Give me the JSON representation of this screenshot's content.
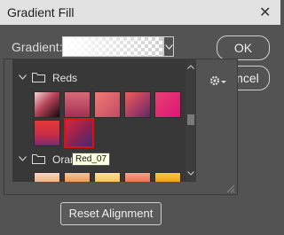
{
  "window": {
    "title": "Gradient Fill"
  },
  "gradient": {
    "label": "Gradient:"
  },
  "buttons": {
    "ok": "OK",
    "cancel": "Cancel",
    "reset_alignment": "Reset Alignment"
  },
  "picker": {
    "groups": [
      {
        "name": "Reds",
        "expanded": true,
        "swatches": [
          "red-1",
          "red-2",
          "red-3",
          "red-4",
          "red-5",
          "red-6",
          "Red_07"
        ]
      },
      {
        "name": "Orange",
        "expanded": true
      }
    ],
    "selected": "Red_07",
    "tooltip": "Red_07"
  },
  "icons": {
    "close": "close-icon",
    "dropdown": "chevron-down-icon",
    "gear": "gear-icon",
    "folder": "folder-icon",
    "expand": "chevron-down-icon",
    "scroll_up": "scroll-up-arrow-icon",
    "scroll_down": "scroll-down-arrow-icon"
  },
  "colors": {
    "selection_border": "#e01010",
    "panel_bg": "#535353",
    "list_bg": "#383838"
  }
}
